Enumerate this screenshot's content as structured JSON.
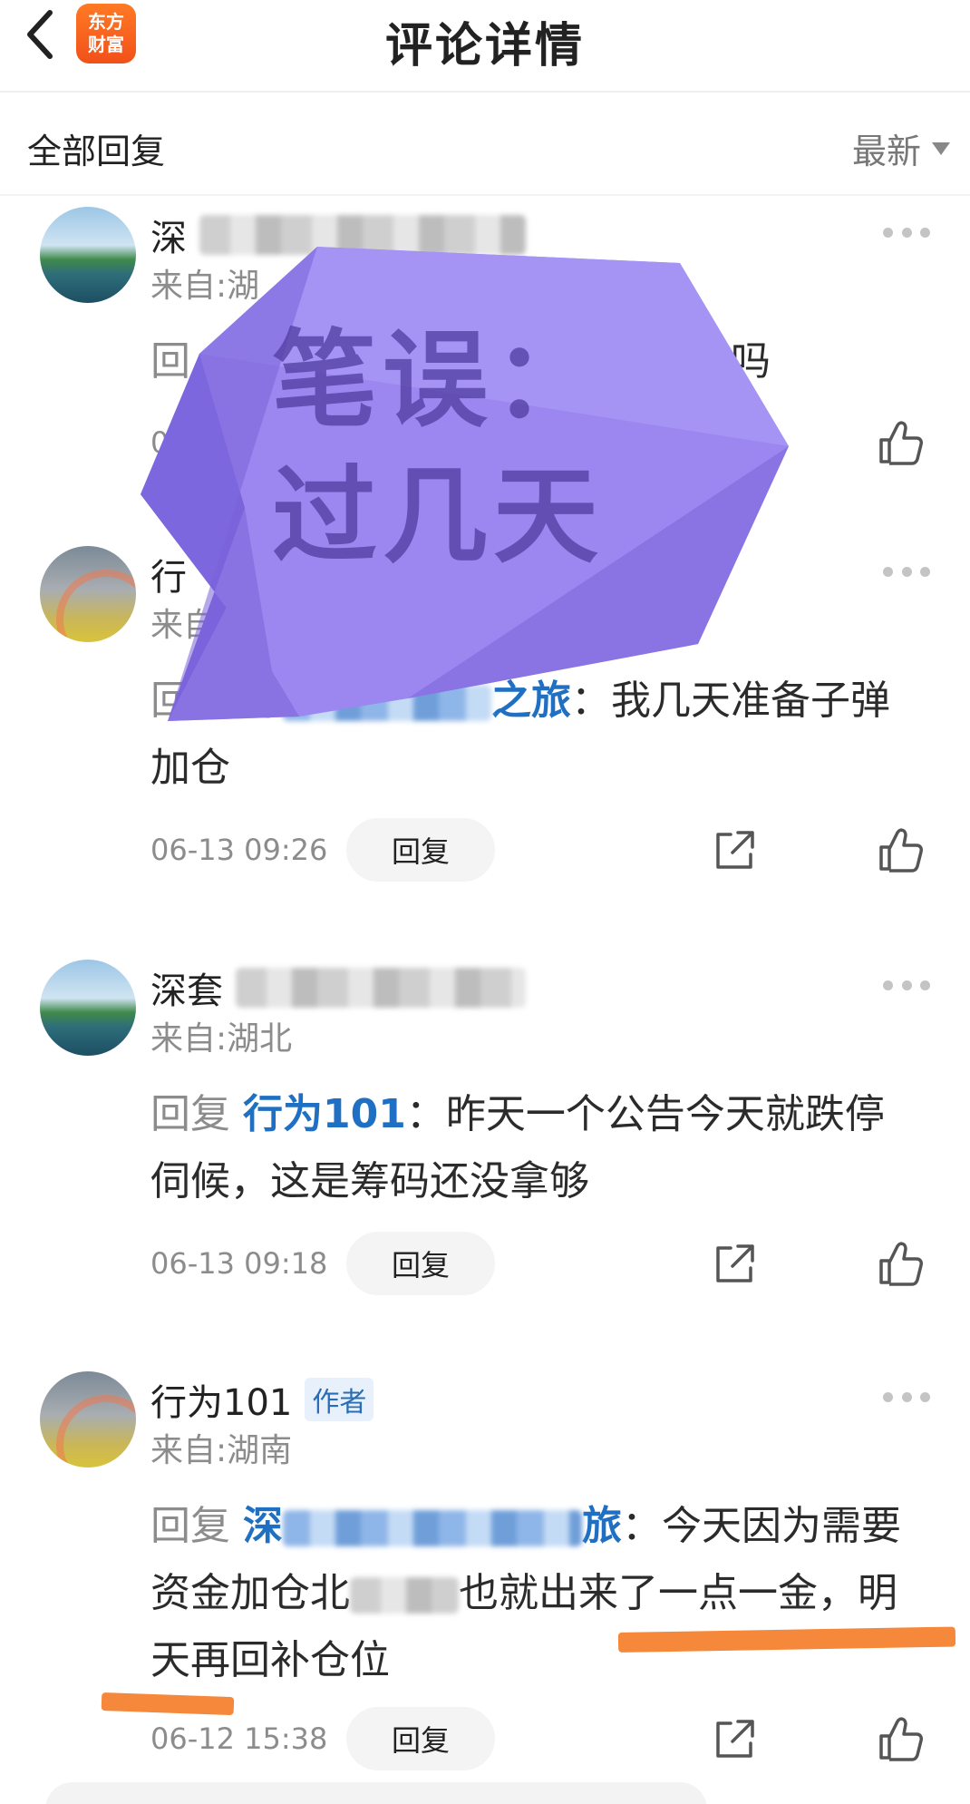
{
  "header": {
    "title": "评论详情",
    "logo_line1": "东方",
    "logo_line2": "财富"
  },
  "subheader": {
    "all_replies": "全部回复",
    "sort_label": "最新"
  },
  "comments": [
    {
      "name_prefix": "深",
      "location": "来自:湖",
      "body_prefix": "回",
      "body_tail": "拿货吗",
      "time": "0",
      "avatar": "lake"
    },
    {
      "name_prefix": "行",
      "location": "来自",
      "reply_word": "回复",
      "mention_prefix": "深",
      "mention_suffix": "之旅",
      "text": "：我几天准备子弹加仓",
      "time": "06-13 09:26",
      "reply_button": "回复",
      "avatar": "rainbow"
    },
    {
      "name_prefix": "深套",
      "location": "来自:湖北",
      "reply_word": "回复",
      "mention": "行为101",
      "text": "：昨天一个公告今天就跌停伺候，这是筹码还没拿够",
      "time": "06-13 09:18",
      "reply_button": "回复",
      "avatar": "lake"
    },
    {
      "name": "行为101",
      "author_tag": "作者",
      "location": "来自:湖南",
      "reply_word": "回复",
      "mention_prefix": "深",
      "mention_suffix": "旅",
      "text_a": "：今天因为需要资金加仓北",
      "text_b": "也就出来了一点一金，明天再回补仓位",
      "time": "06-12 15:38",
      "reply_button": "回复",
      "avatar": "rainbow"
    }
  ],
  "sticker": {
    "line1": "笔误：",
    "line2": "过几天",
    "color": "#9b87ef"
  },
  "colors": {
    "mention": "#1f6fc2",
    "highlight": "#f5883a"
  },
  "icons": [
    "back-arrow-icon",
    "more-dots-icon",
    "share-icon",
    "thumbs-up-icon",
    "sort-caret-icon"
  ]
}
